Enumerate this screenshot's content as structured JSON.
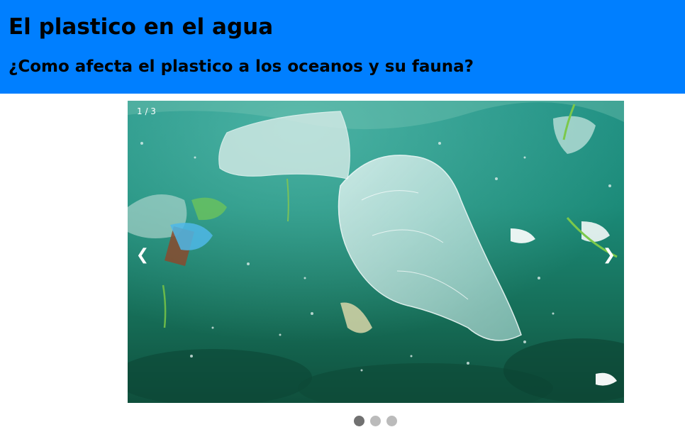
{
  "header": {
    "title": "El plastico en el agua",
    "subtitle": "¿Como afecta el plastico a los oceanos y su fauna?",
    "background_color": "#007fff"
  },
  "slideshow": {
    "number_text": "1 / 3",
    "current_slide": 1,
    "total_slides": 3,
    "prev_symbol": "❮",
    "next_symbol": "❯",
    "dots": [
      {
        "state": "active",
        "color": "#717171"
      },
      {
        "state": "inactive",
        "color": "#bbbbbb"
      },
      {
        "state": "inactive",
        "color": "#bbbbbb"
      }
    ]
  }
}
